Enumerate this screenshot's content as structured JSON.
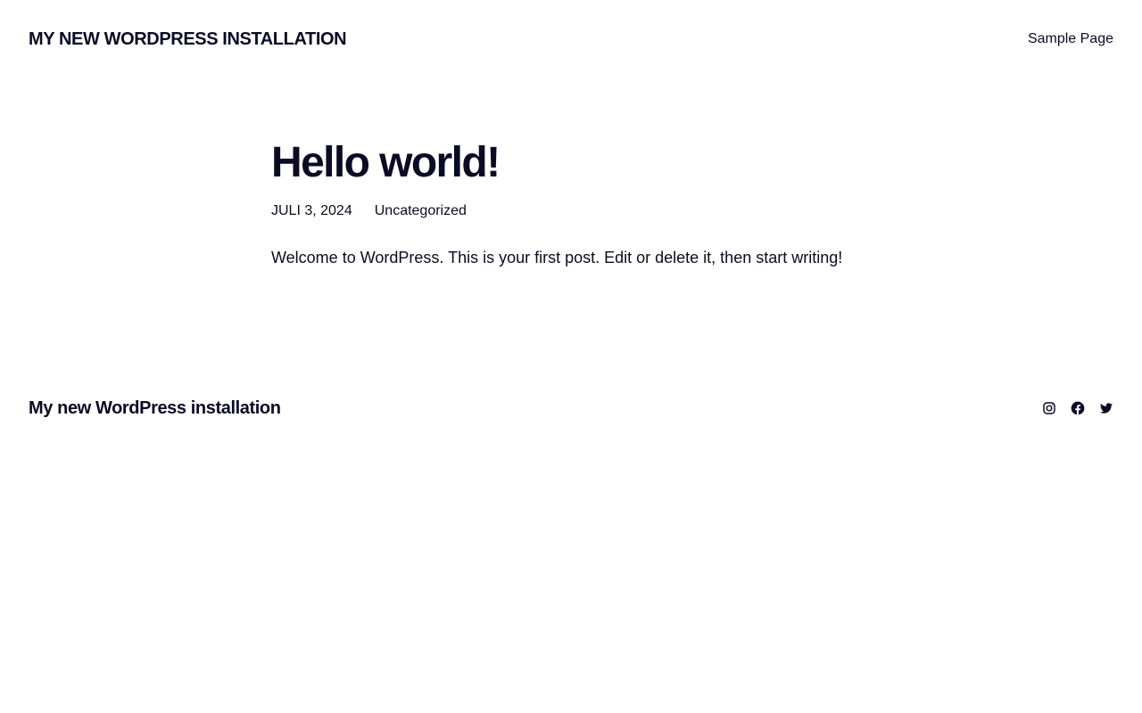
{
  "header": {
    "site_title": "MY NEW WORDPRESS INSTALLATION",
    "nav": [
      {
        "label": "Sample Page"
      }
    ]
  },
  "post": {
    "title": "Hello world!",
    "date": "JULI 3, 2024",
    "category": "Uncategorized",
    "content": "Welcome to WordPress. This is your first post. Edit or delete it, then start writing!"
  },
  "footer": {
    "site_title": "My new WordPress installation",
    "social_icons": [
      "instagram-icon",
      "facebook-icon",
      "twitter-icon"
    ]
  },
  "colors": {
    "text": "#0b0b24",
    "background": "#ffffff"
  }
}
